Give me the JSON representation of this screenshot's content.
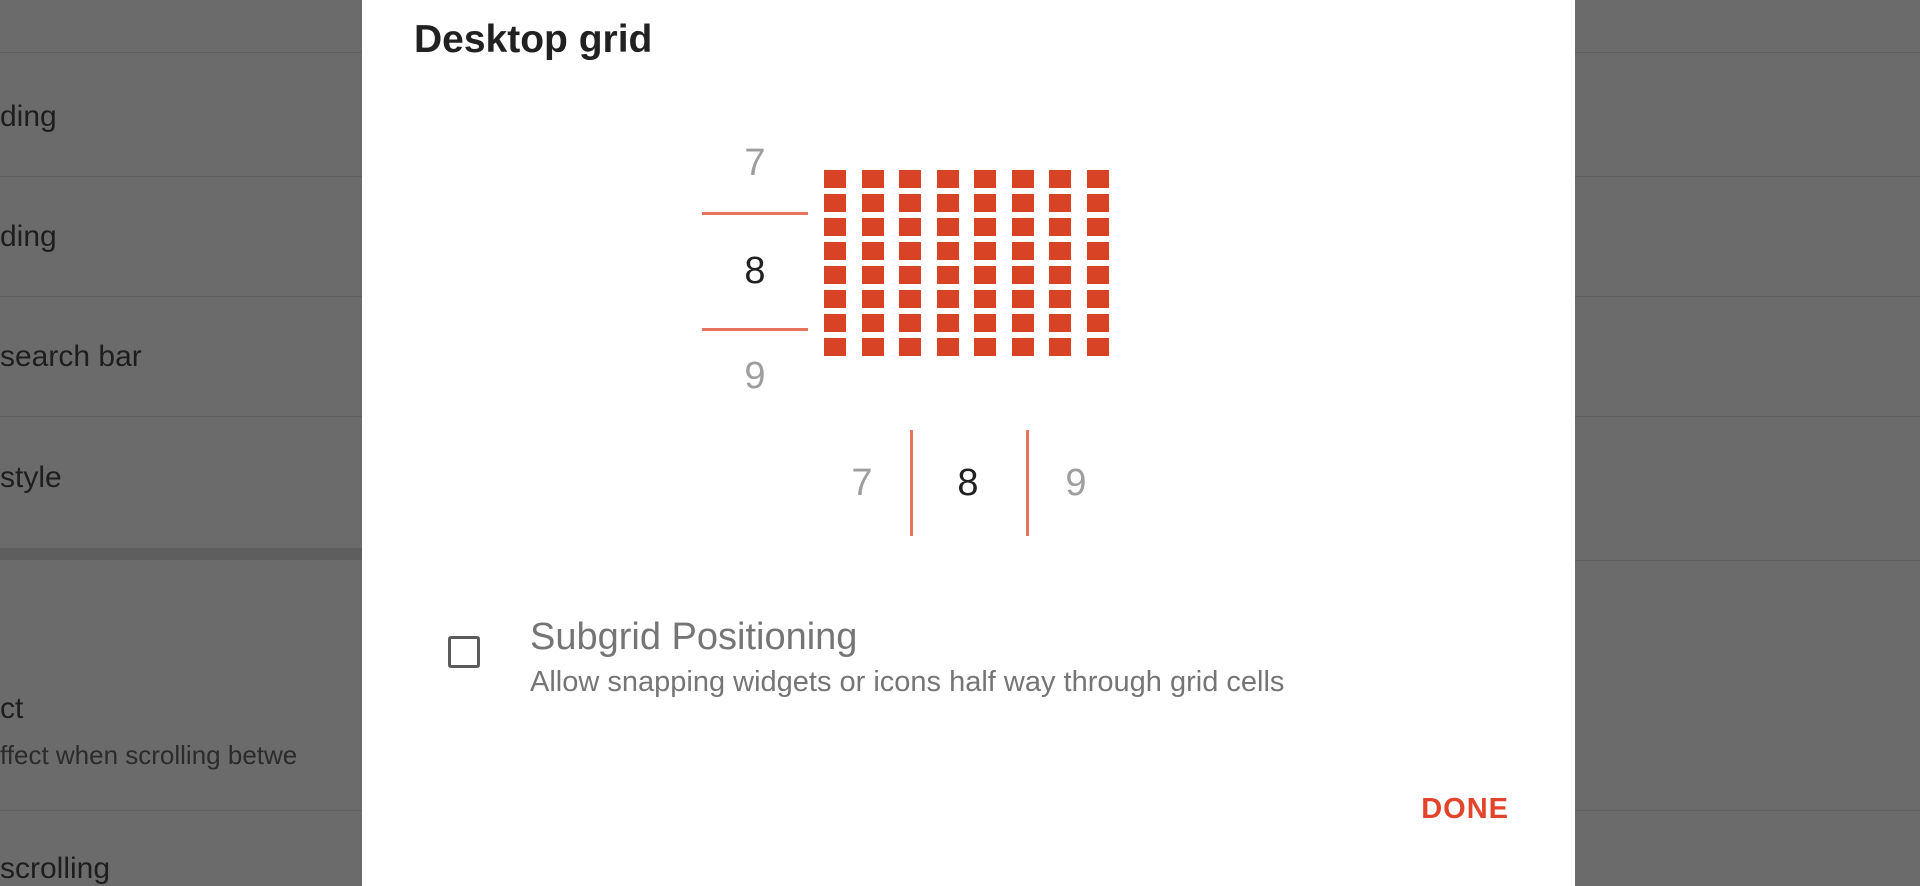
{
  "background_settings": {
    "rows": [
      {
        "title": "ding"
      },
      {
        "title": "ding"
      },
      {
        "title": "search bar"
      },
      {
        "title": " style"
      },
      {
        "title": "ct",
        "subtitle": "ffect when scrolling betwe"
      },
      {
        "title": "scrolling"
      }
    ]
  },
  "dialog": {
    "title": "Desktop grid",
    "rows_picker": {
      "prev": "7",
      "selected": "8",
      "next": "9"
    },
    "columns_picker": {
      "prev": "7",
      "selected": "8",
      "next": "9"
    },
    "grid_preview": {
      "rows": 8,
      "columns": 8,
      "color": "#d84326"
    },
    "subgrid_option": {
      "label": "Subgrid Positioning",
      "description": "Allow snapping widgets or icons half way through grid cells",
      "checked": false
    },
    "done_label": "DONE",
    "accent_color": "#e2452c"
  }
}
